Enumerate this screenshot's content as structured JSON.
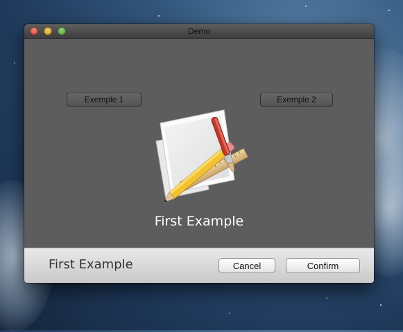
{
  "window": {
    "title": "Demo"
  },
  "content": {
    "buttons": {
      "example1": "Exemple 1",
      "example2": "Exemple 2"
    },
    "icon": "app-icon-pencil-ruler",
    "label": "First Example"
  },
  "bottom": {
    "label": "First Example",
    "cancel": "Cancel",
    "confirm": "Confirm"
  }
}
